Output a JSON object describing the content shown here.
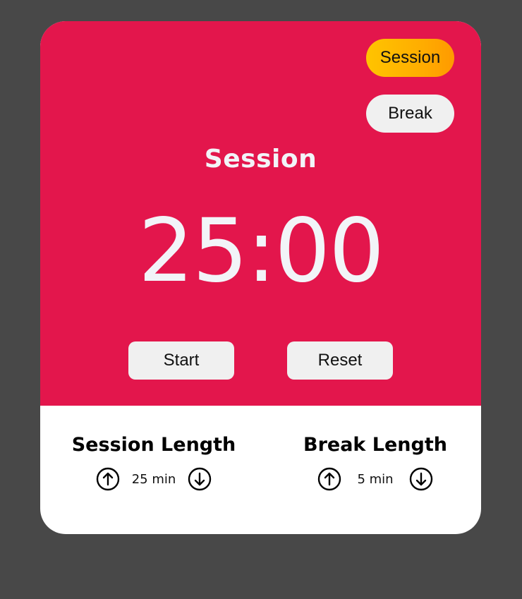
{
  "colors": {
    "page_background": "#484848",
    "timer_panel": "#e3164c",
    "active_mode_gradient": [
      "#ffc400",
      "#ff9a00"
    ],
    "button_background": "#f0f0f0",
    "timer_text": "#f2f4f8",
    "settings_background": "#ffffff"
  },
  "modes": {
    "session_label": "Session",
    "break_label": "Break",
    "active": "session"
  },
  "timer": {
    "mode_title": "Session",
    "display": "25:00"
  },
  "controls": {
    "start_label": "Start",
    "reset_label": "Reset"
  },
  "settings": {
    "session": {
      "title": "Session Length",
      "value": "25 min",
      "increment_icon": "arrow-up-circle-icon",
      "decrement_icon": "arrow-down-circle-icon"
    },
    "break": {
      "title": "Break Length",
      "value": "5 min",
      "increment_icon": "arrow-up-circle-icon",
      "decrement_icon": "arrow-down-circle-icon"
    }
  }
}
